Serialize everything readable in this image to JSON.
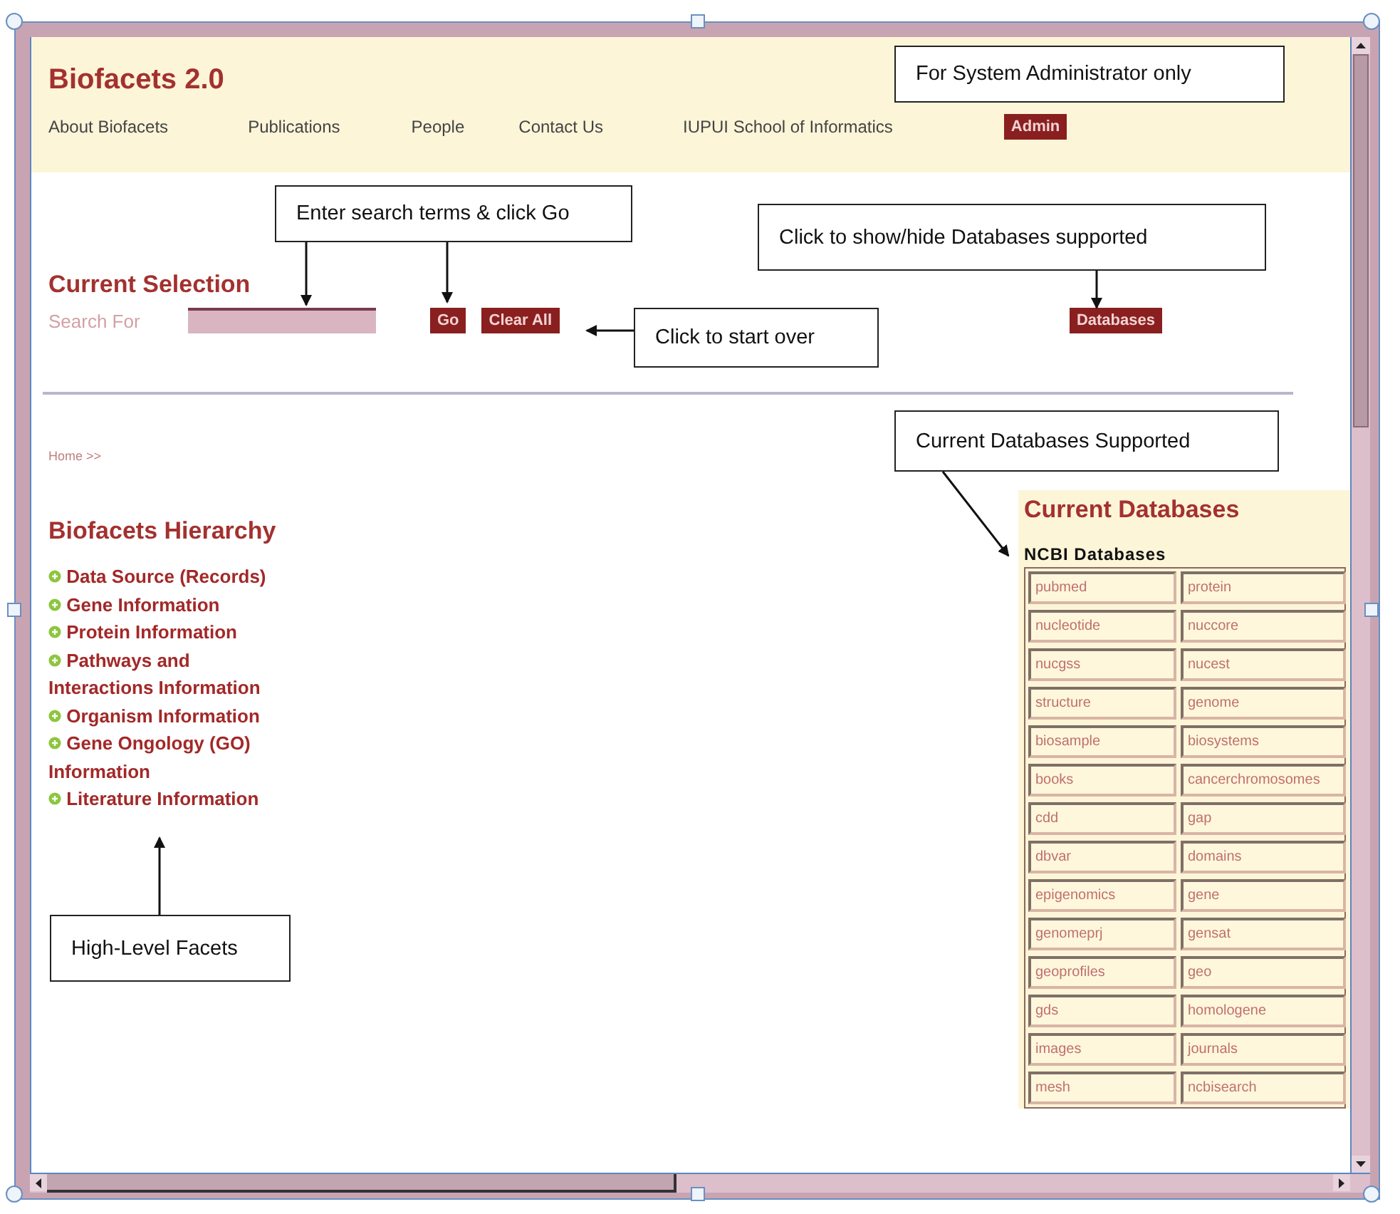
{
  "header": {
    "title": "Biofacets 2.0",
    "nav": [
      "About Biofacets",
      "Publications",
      "People",
      "Contact Us",
      "IUPUI School of Informatics"
    ],
    "admin_button": "Admin"
  },
  "search": {
    "heading": "Current Selection",
    "label": "Search For",
    "go_button": "Go",
    "clear_button": "Clear All",
    "databases_button": "Databases"
  },
  "breadcrumb": "Home >>",
  "hierarchy": {
    "heading": "Biofacets Hierarchy",
    "items": [
      "Data Source (Records)",
      "Gene Information",
      "Protein Information",
      "Pathways and Interactions Information",
      "Organism Information",
      "Gene Ongology (GO) Information",
      "Literature Information"
    ]
  },
  "databases": {
    "heading": "Current Databases",
    "group": "NCBI Databases",
    "rows": [
      [
        "pubmed",
        "protein"
      ],
      [
        "nucleotide",
        "nuccore"
      ],
      [
        "nucgss",
        "nucest"
      ],
      [
        "structure",
        "genome"
      ],
      [
        "biosample",
        "biosystems"
      ],
      [
        "books",
        "cancerchromosomes"
      ],
      [
        "cdd",
        "gap"
      ],
      [
        "dbvar",
        "domains"
      ],
      [
        "epigenomics",
        "gene"
      ],
      [
        "genomeprj",
        "gensat"
      ],
      [
        "geoprofiles",
        "geo"
      ],
      [
        "gds",
        "homologene"
      ],
      [
        "images",
        "journals"
      ],
      [
        "mesh",
        "ncbisearch"
      ]
    ]
  },
  "callouts": [
    "For System Administrator only",
    "Enter search terms & click Go",
    "Click to show/hide Databases supported",
    "Click to start over",
    "Current Databases Supported",
    "High-Level Facets"
  ]
}
